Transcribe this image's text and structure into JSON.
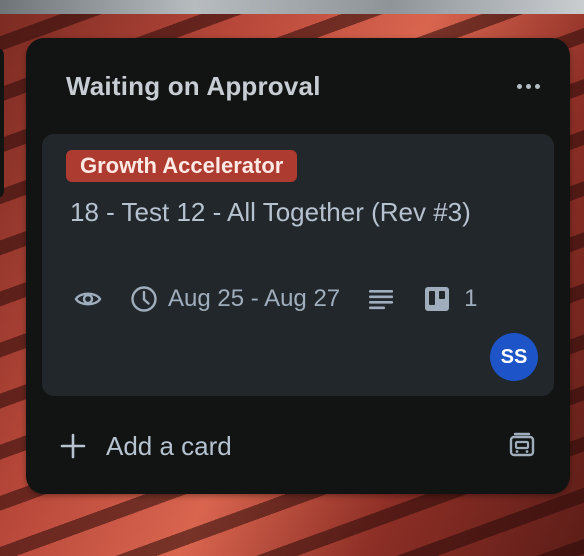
{
  "list": {
    "title": "Waiting on Approval",
    "menu_icon": "more-horizontal-icon",
    "add_card_label": "Add a card",
    "add_icon": "plus-icon",
    "template_icon": "card-template-icon"
  },
  "card": {
    "label": {
      "text": "Growth Accelerator",
      "color": "#ae3b30"
    },
    "title": "18 - Test 12 - All Together (Rev #3)",
    "badges": {
      "watch_icon": "eye-icon",
      "date_icon": "clock-icon",
      "date_range": "Aug 25 - Aug 27",
      "description_icon": "description-icon",
      "checklist_icon": "board-icon",
      "checklist_count": "1"
    },
    "member": {
      "initials": "SS",
      "color": "#1d55c9"
    }
  }
}
